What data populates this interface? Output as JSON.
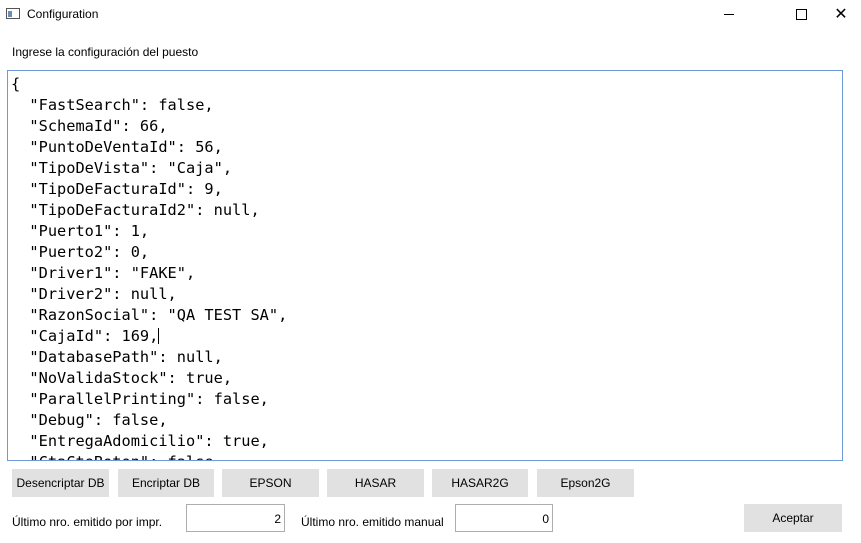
{
  "window": {
    "title": "Configuration",
    "controls": {
      "minimize": "–",
      "maximize": "□",
      "close": "✕"
    }
  },
  "prompt": "Ingrese la configuración del puesto",
  "editor": {
    "lines_before_caret": "{\n  \"FastSearch\": false,\n  \"SchemaId\": 66,\n  \"PuntoDeVentaId\": 56,\n  \"TipoDeVista\": \"Caja\",\n  \"TipoDeFacturaId\": 9,\n  \"TipoDeFacturaId2\": null,\n  \"Puerto1\": 1,\n  \"Puerto2\": 0,\n  \"Driver1\": \"FAKE\",\n  \"Driver2\": null,\n  \"RazonSocial\": \"QA TEST SA\",\n  \"CajaId\": 169,",
    "lines_after_caret": "\n  \"DatabasePath\": null,\n  \"NoValidaStock\": true,\n  \"ParallelPrinting\": false,\n  \"Debug\": false,\n  \"EntregaAdomicilio\": true,\n  \"CtaCteBoton\": false"
  },
  "buttons": {
    "desencriptar": "Desencriptar DB",
    "encriptar": "Encriptar DB",
    "epson": "EPSON",
    "hasar": "HASAR",
    "hasar2g": "HASAR2G",
    "epson2g": "Epson2G",
    "aceptar": "Aceptar"
  },
  "fields": {
    "ultimo_impr_label": "Último nro. emitido por impr.",
    "ultimo_impr_value": "2",
    "ultimo_manual_label": "Último nro. emitido manual",
    "ultimo_manual_value": "0"
  },
  "colors": {
    "editor_border": "#6d9ad6",
    "button_bg": "#e1e1e1"
  }
}
